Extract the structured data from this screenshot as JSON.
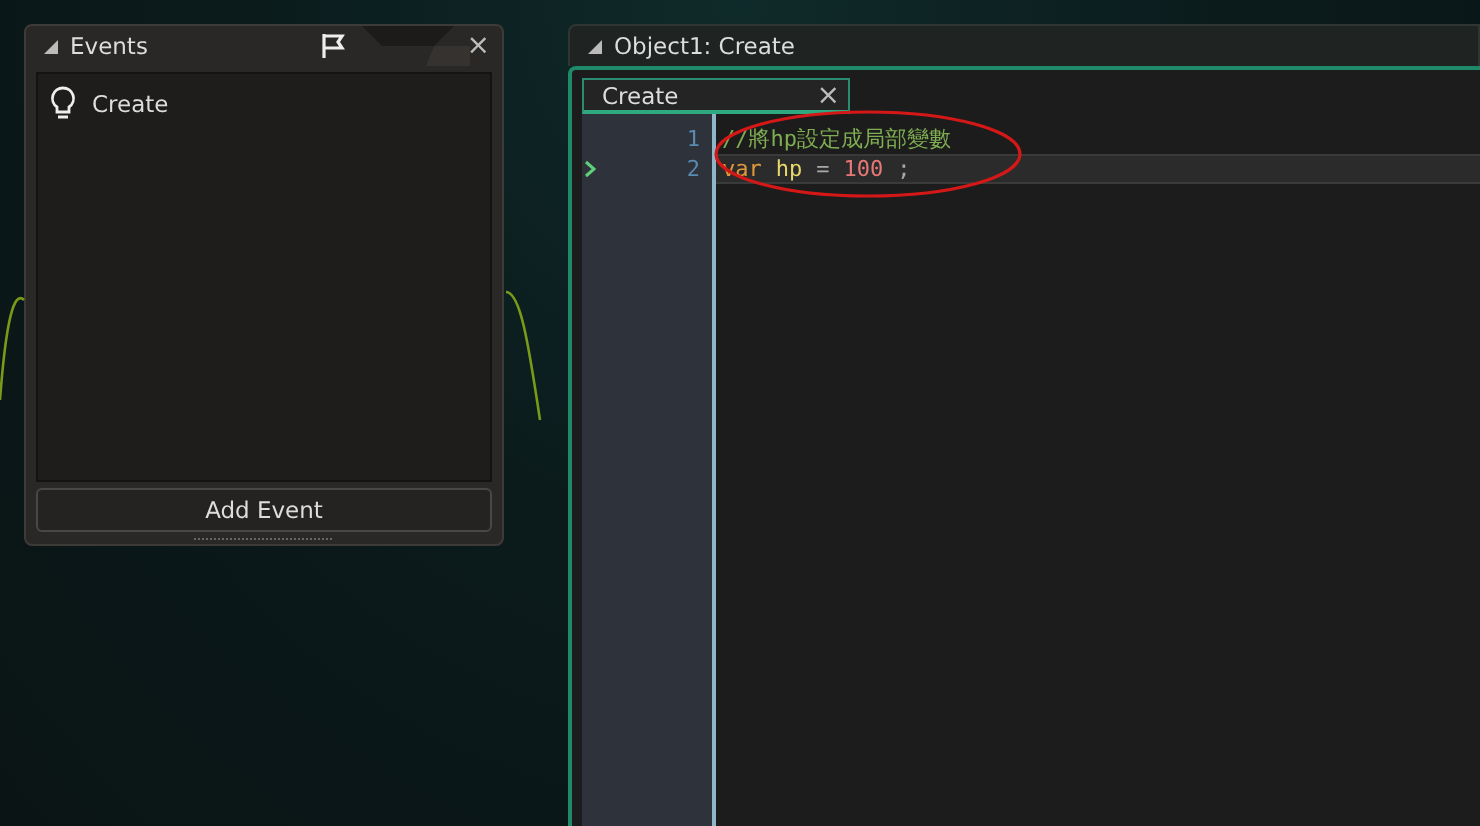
{
  "events_panel": {
    "title": "Events",
    "close": "×",
    "events": [
      {
        "label": "Create",
        "selected": false
      }
    ],
    "add_button": "Add Event"
  },
  "editor_panel": {
    "title": "Object1: Create",
    "tabs": [
      {
        "label": "Create",
        "selected": true,
        "close": "×"
      }
    ],
    "lines": [
      {
        "number": "1",
        "current": false,
        "tokens": [
          {
            "kind": "comment",
            "text": "//將hp設定成局部變數"
          }
        ]
      },
      {
        "number": "2",
        "current": true,
        "tokens": [
          {
            "kind": "keyword",
            "text": "var"
          },
          {
            "kind": "variable",
            "text": "hp"
          },
          {
            "kind": "operator",
            "text": "="
          },
          {
            "kind": "number",
            "text": "100"
          },
          {
            "kind": "operator",
            "text": ";"
          }
        ]
      }
    ]
  }
}
